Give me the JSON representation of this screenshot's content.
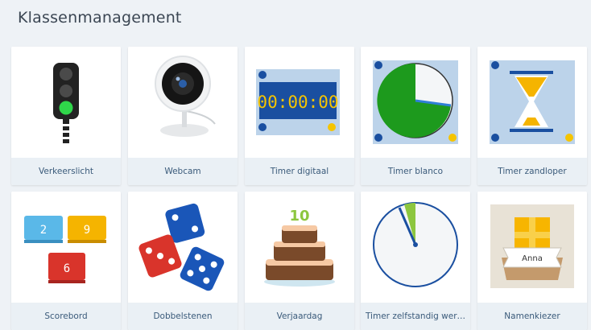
{
  "header": {
    "title": "Klassenmanagement"
  },
  "tiles": [
    {
      "label": "Verkeerslicht",
      "icon": "traffic-light-icon"
    },
    {
      "label": "Webcam",
      "icon": "webcam-icon"
    },
    {
      "label": "Timer digitaal",
      "icon": "digital-timer-icon",
      "display": "00:00:00"
    },
    {
      "label": "Timer blanco",
      "icon": "pie-timer-icon"
    },
    {
      "label": "Timer zandloper",
      "icon": "hourglass-icon"
    },
    {
      "label": "Scorebord",
      "icon": "scoreboard-icon",
      "scores": [
        "2",
        "9",
        "6"
      ]
    },
    {
      "label": "Dobbelstenen",
      "icon": "dice-icon"
    },
    {
      "label": "Verjaardag",
      "icon": "birthday-cake-icon",
      "cake_number": "10"
    },
    {
      "label": "Timer zelfstandig wer…",
      "icon": "self-work-timer-icon"
    },
    {
      "label": "Namenkiezer",
      "icon": "name-picker-icon",
      "name": "Anna"
    }
  ]
}
